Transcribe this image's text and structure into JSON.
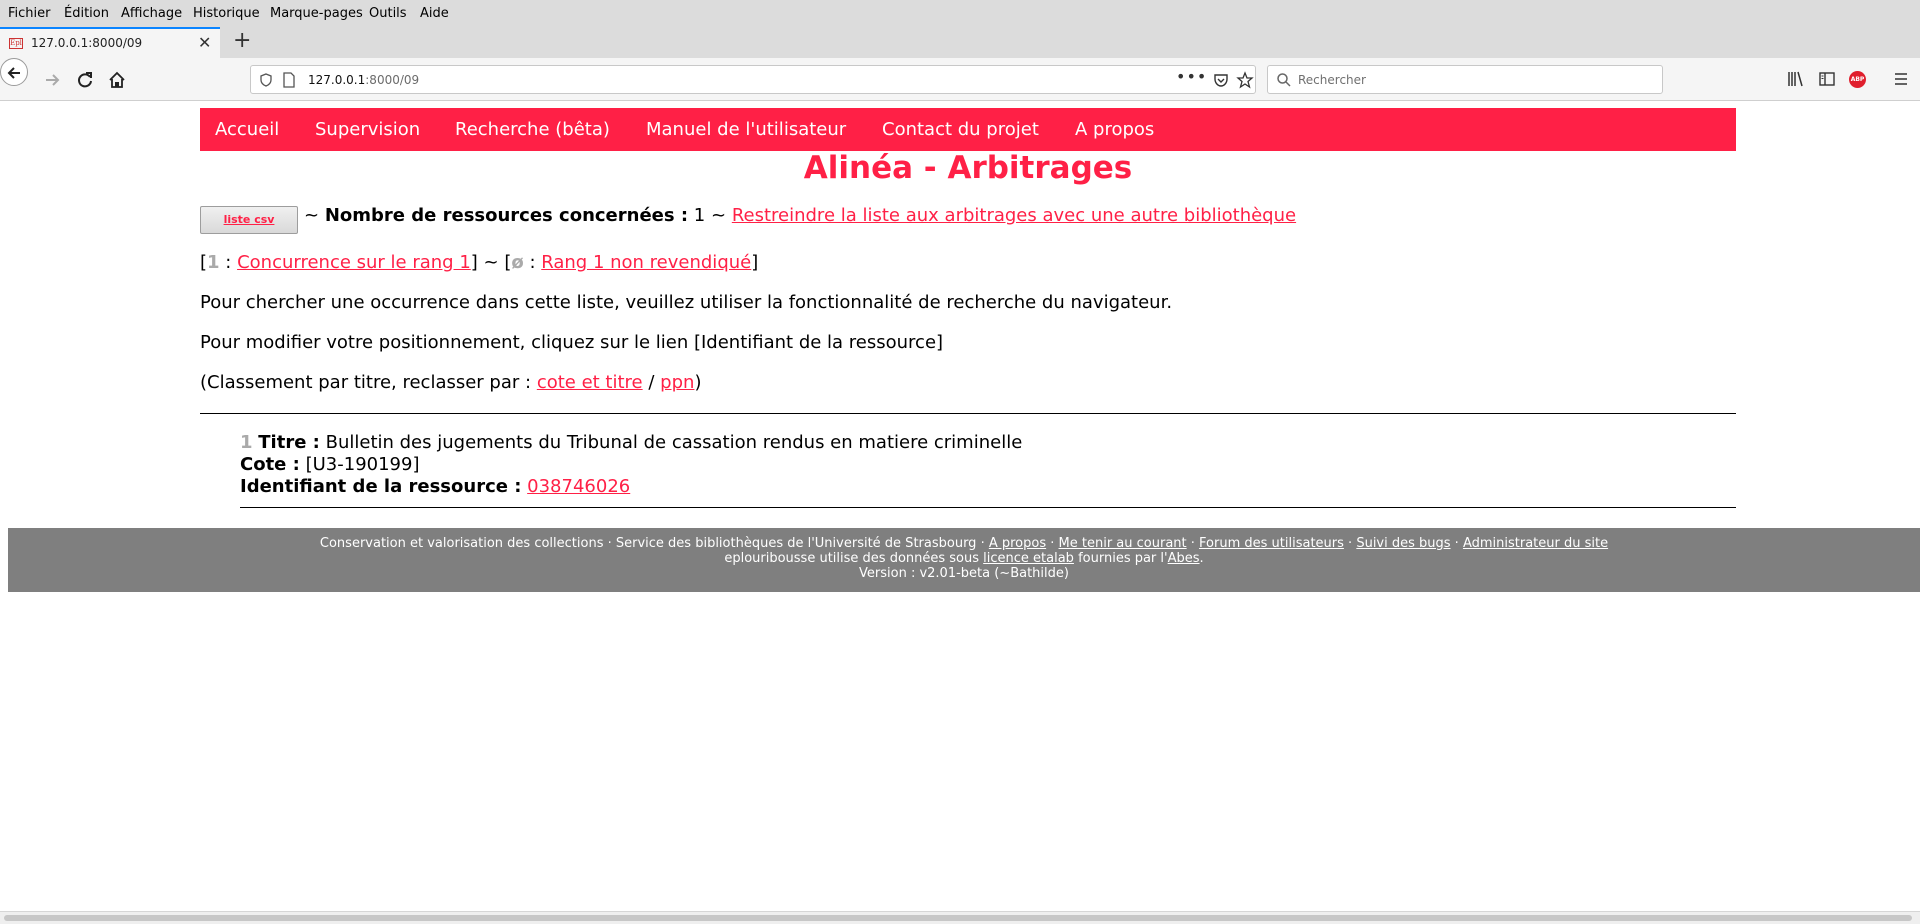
{
  "browser": {
    "menu": [
      "Fichier",
      "Édition",
      "Affichage",
      "Historique",
      "Marque-pages",
      "Outils",
      "Aide"
    ],
    "tab_favicon": "Epl",
    "tab_title": "127.0.0.1:8000/09",
    "url_host": "127.0.0.1",
    "url_rest": ":8000/09",
    "search_placeholder": "Rechercher",
    "abp_label": "ABP"
  },
  "site": {
    "nav": [
      "Accueil",
      "Supervision",
      "Recherche (bêta)",
      "Manuel de l'utilisateur",
      "Contact du projet",
      "A propos"
    ],
    "title": "Alinéa - Arbitrages",
    "csv_button": "liste csv",
    "sep": "~",
    "count_label": "Nombre de ressources concernées :",
    "count_value": "1",
    "restrict_link": "Restreindre la liste aux arbitrages avec une autre bibliothèque",
    "legend": {
      "rank1_symbol": "1",
      "rank1_link": "Concurrence sur le rang 1",
      "none_symbol": "ø",
      "none_link": "Rang 1 non revendiqué"
    },
    "info1": "Pour chercher une occurrence dans cette liste, veuillez utiliser la fonctionnalité de recherche du navigateur.",
    "info2": "Pour modifier votre positionnement, cliquez sur le lien [Identifiant de la ressource]",
    "sort": {
      "prefix": "(Classement par titre, reclasser par :",
      "link1": "cote et titre",
      "slash": "/",
      "link2": "ppn",
      "suffix": ")"
    },
    "record": {
      "rank": "1",
      "title_label": "Titre :",
      "title_value": "Bulletin des jugements du Tribunal de cassation rendus en matiere criminelle",
      "cote_label": "Cote :",
      "cote_value": "[U3-190199]",
      "id_label": "Identifiant de la ressource :",
      "id_value": "038746026"
    },
    "footer": {
      "l1_text": "Conservation et valorisation des collections · Service des bibliothèques de l'Université de Strasbourg ·",
      "l1_link1": "A propos",
      "l1_link2": "Me tenir au courant",
      "l1_link3": "Forum des utilisateurs",
      "l1_link4": "Suivi des bugs",
      "l1_link5": "Administrateur du site",
      "l2_text1": "eplouribousse utilise des données sous",
      "l2_link1": "licence etalab",
      "l2_text2": "fournies par l'",
      "l2_link2": "Abes",
      "l3_text": "Version : v2.01-beta (~Bathilde)"
    }
  },
  "colors": {
    "accent": "#ff2046",
    "footer_bg": "#7f7f7f"
  }
}
